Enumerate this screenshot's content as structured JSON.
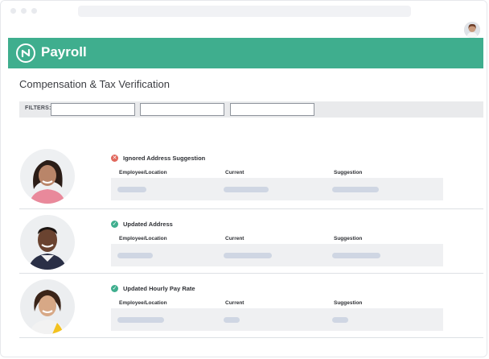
{
  "header": {
    "brand": "Payroll"
  },
  "page": {
    "title": "Compensation & Tax Verification"
  },
  "filters": {
    "label": "FILTERS:",
    "inputs": [
      {
        "value": ""
      },
      {
        "value": ""
      },
      {
        "value": ""
      }
    ]
  },
  "columns": {
    "employee_location": "Employee/Location",
    "current": "Current",
    "suggestion": "Suggestion"
  },
  "records": [
    {
      "status": "Ignored Address Suggestion",
      "status_type": "ignored",
      "status_color": "#e0675c"
    },
    {
      "status": "Updated Address",
      "status_type": "updated",
      "status_color": "#3fae8e"
    },
    {
      "status": "Updated Hourly Pay Rate",
      "status_type": "updated",
      "status_color": "#3fae8e"
    }
  ],
  "colors": {
    "brand": "#3fae8e",
    "ignored": "#e0675c",
    "placeholder_pill": "#cfd6e3"
  }
}
